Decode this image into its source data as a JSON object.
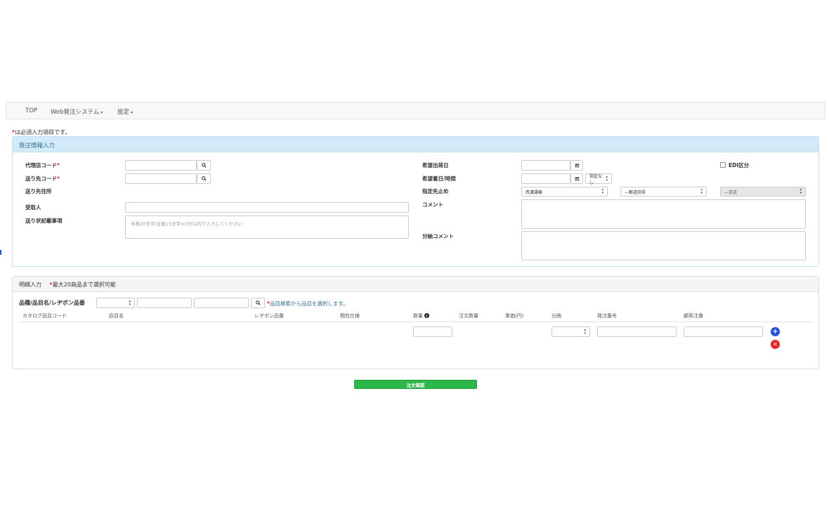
{
  "nav": {
    "top": "TOP",
    "web_order": "Web発注システム",
    "settings": "設定",
    "caret": "▾"
  },
  "required_note": "は必須入力項目です。",
  "required_mark": "*",
  "order_info": {
    "title": "発注情報入力",
    "agency_code_label": "代理店コード",
    "dest_code_label": "送り先コード",
    "dest_address_label": "送り先住所",
    "recipient_label": "受取人",
    "slip_note_label": "送り状記載事項",
    "slip_note_placeholder": "半角30文字(全角15文字)x3行以内で入力してください",
    "ship_date_label": "希望出荷日",
    "arrival_label": "希望着日/時間",
    "time_select": "指定なし",
    "stop_label": "指定先止め",
    "carrier_select": "西濃運輸",
    "prefecture_select": "—都道府県",
    "branch_select": "—支店",
    "comment_label": "コメント",
    "split_comment_label": "分納コメント",
    "edi_label": "EDI区分"
  },
  "detail": {
    "title": "明細入力",
    "max_note": "最大20商品まで選択可能",
    "search_label": "品種/品目名/レヂボン品番",
    "search_hint": "品目検索から品目を選択します。",
    "columns": {
      "catalog_code": "カタログ品目コード",
      "item_name": "品目名",
      "redibon_no": "レヂボン品番",
      "packing": "梱包仕様",
      "quantity": "数量",
      "order_qty": "注文数量",
      "unit_price": "単価(円)",
      "split": "分納",
      "order_no": "発注番号",
      "customer_no": "顧客注番"
    }
  },
  "confirm_button": "注文確認",
  "colors": {
    "panel_head_bg": "#d3eaf8",
    "panel_head_text": "#31708f",
    "confirm_green": "#2db74a",
    "add_blue": "#2451d6",
    "remove_red": "#e02626",
    "required_red": "#d9261c"
  },
  "icons": {
    "search": "search-icon",
    "calendar": "calendar-icon",
    "info": "info-icon",
    "add": "plus-circle-icon",
    "remove": "x-circle-icon"
  }
}
